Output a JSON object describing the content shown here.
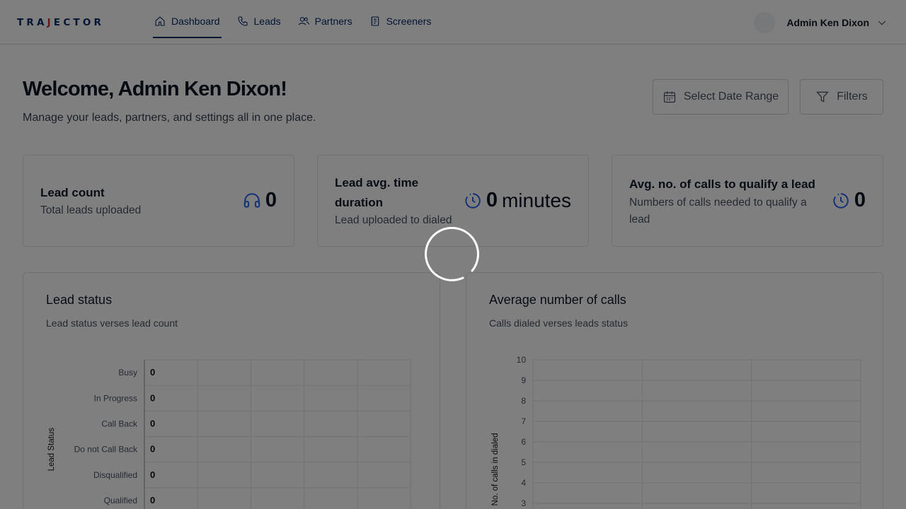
{
  "app": {
    "logo_text": "TRAJECTOR"
  },
  "nav": {
    "items": [
      {
        "label": "Dashboard",
        "icon": "home-icon",
        "active": true
      },
      {
        "label": "Leads",
        "icon": "phone-icon",
        "active": false
      },
      {
        "label": "Partners",
        "icon": "users-icon",
        "active": false
      },
      {
        "label": "Screeners",
        "icon": "clipboard-icon",
        "active": false
      }
    ]
  },
  "user": {
    "name": "Admin Ken Dixon"
  },
  "page": {
    "title": "Welcome, Admin Ken Dixon!",
    "subtitle": "Manage your leads, partners, and settings all in one place.",
    "date_range_label": "Select Date Range",
    "filters_label": "Filters"
  },
  "stats": [
    {
      "title": "Lead count",
      "subtitle": "Total leads uploaded",
      "value": "0",
      "unit": "",
      "icon": "headphones-icon"
    },
    {
      "title_line1": "Lead avg. time",
      "title_line2": "duration",
      "subtitle": "Lead uploaded to dialed",
      "value": "0",
      "unit": "minutes",
      "icon": "timer-icon"
    },
    {
      "title": "Avg. no. of calls to qualify a lead",
      "subtitle_line1": "Numbers of calls needed to qualify a",
      "subtitle_line2": "lead",
      "value": "0",
      "unit": "",
      "icon": "timer-icon"
    }
  ],
  "colors": {
    "brand": "#0a2a66",
    "accent": "#2563eb",
    "logo_accent": "#d0342c"
  },
  "chart_data": [
    {
      "type": "bar",
      "title": "Lead status",
      "subtitle": "Lead status verses lead count",
      "orientation": "horizontal",
      "ylabel": "Lead Status",
      "categories": [
        "Busy",
        "In Progress",
        "Call Back",
        "Do not Call Back",
        "Disqualified",
        "Qualified"
      ],
      "values": [
        0,
        0,
        0,
        0,
        0,
        0
      ],
      "grid": true
    },
    {
      "type": "bar",
      "title": "Average number of calls",
      "subtitle": "Calls dialed verses leads status",
      "ylabel": "No. of calls in dialed",
      "ylim": [
        0,
        10
      ],
      "yticks": [
        3,
        4,
        5,
        6,
        7,
        8,
        9,
        10
      ],
      "values": [],
      "grid": true
    }
  ]
}
